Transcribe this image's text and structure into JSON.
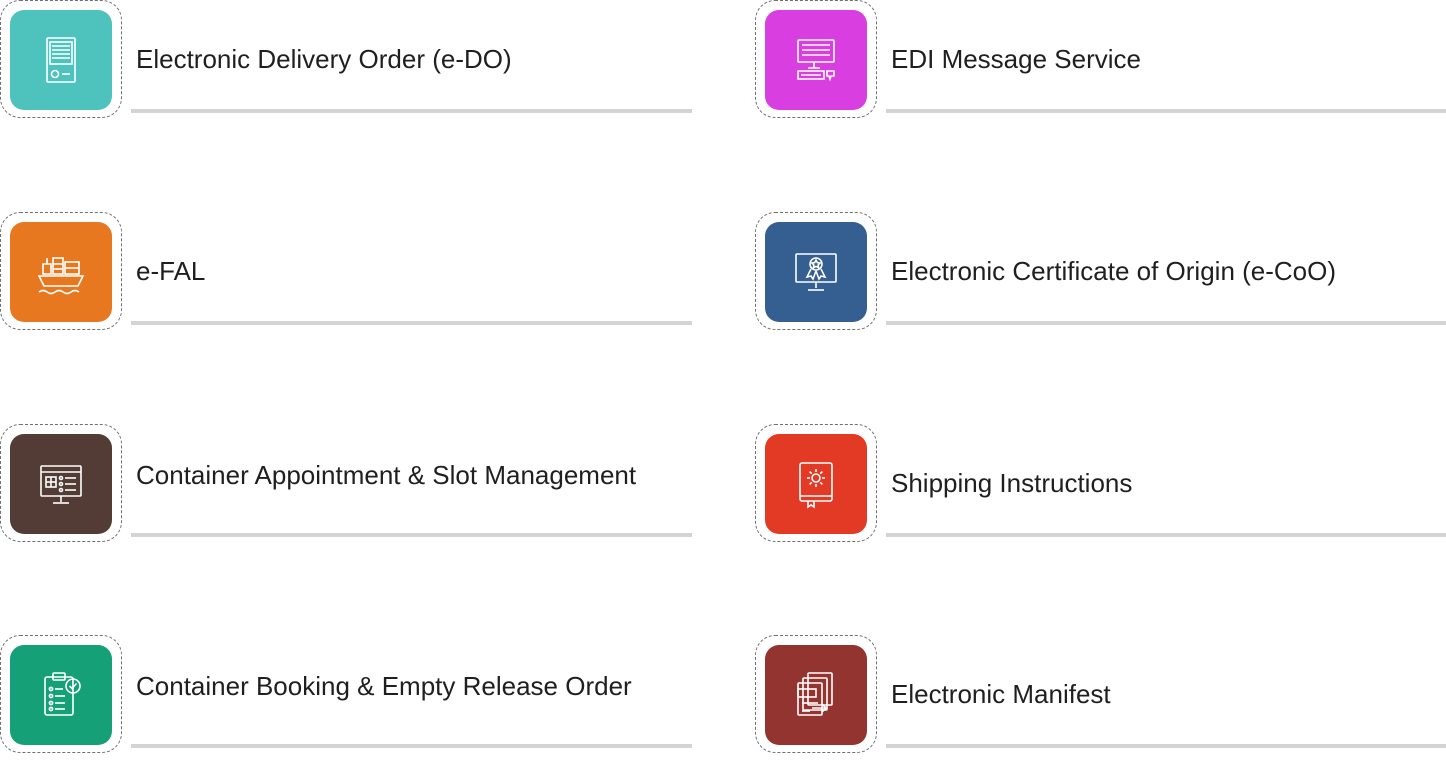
{
  "services": [
    {
      "id": "e-do",
      "label": "Electronic Delivery Order (e-DO)",
      "color": "#4ec2bd",
      "icon": "document-icon"
    },
    {
      "id": "edi",
      "label": "EDI Message Service",
      "color": "#d83ee0",
      "icon": "computer-icon"
    },
    {
      "id": "e-fal",
      "label": "e-FAL",
      "color": "#e8781f",
      "icon": "ship-icon"
    },
    {
      "id": "e-coo",
      "label": "Electronic Certificate of Origin (e-CoO)",
      "color": "#355e91",
      "icon": "certificate-monitor-icon"
    },
    {
      "id": "container-appointment",
      "label": "Container Appointment & Slot Management",
      "color": "#533b36",
      "icon": "monitor-list-icon"
    },
    {
      "id": "shipping-instructions",
      "label": "Shipping Instructions",
      "color": "#e23a25",
      "icon": "gear-book-icon"
    },
    {
      "id": "container-booking",
      "label": "Container Booking & Empty Release Order",
      "color": "#16a078",
      "icon": "clipboard-check-icon"
    },
    {
      "id": "e-manifest",
      "label": "Electronic Manifest",
      "color": "#943430",
      "icon": "manifest-icon"
    }
  ]
}
